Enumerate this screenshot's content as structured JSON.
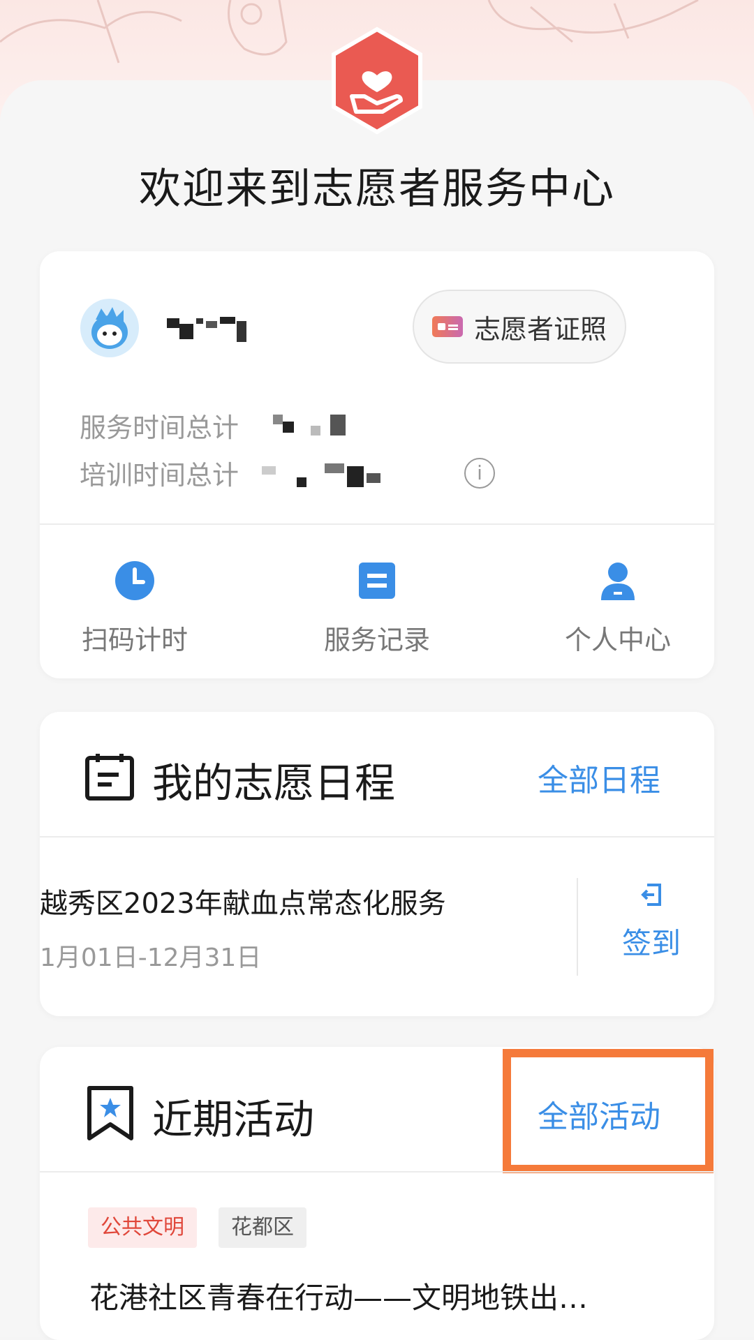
{
  "welcome_title": "欢迎来到志愿者服务中心",
  "profile": {
    "certificate_button": "志愿者证照",
    "service_time_label": "服务时间总计",
    "training_time_label": "培训时间总计",
    "info_icon": "info-icon"
  },
  "quick_actions": [
    {
      "label": "扫码计时",
      "icon": "clock-icon"
    },
    {
      "label": "服务记录",
      "icon": "record-icon"
    },
    {
      "label": "个人中心",
      "icon": "person-icon"
    }
  ],
  "schedule": {
    "title": "我的志愿日程",
    "link": "全部日程",
    "event_title": "越秀区2023年献血点常态化服务",
    "event_date": "1月01日-12月31日",
    "signin_label": "签到"
  },
  "activities": {
    "title": "近期活动",
    "link": "全部活动",
    "tags": [
      "公共文明",
      "花都区"
    ],
    "first_title": "花港社区青春在行动——文明地铁出…"
  },
  "colors": {
    "accent_blue": "#3a8ee6",
    "logo_red": "#ea5a52",
    "highlight_orange": "#f57a3a"
  }
}
